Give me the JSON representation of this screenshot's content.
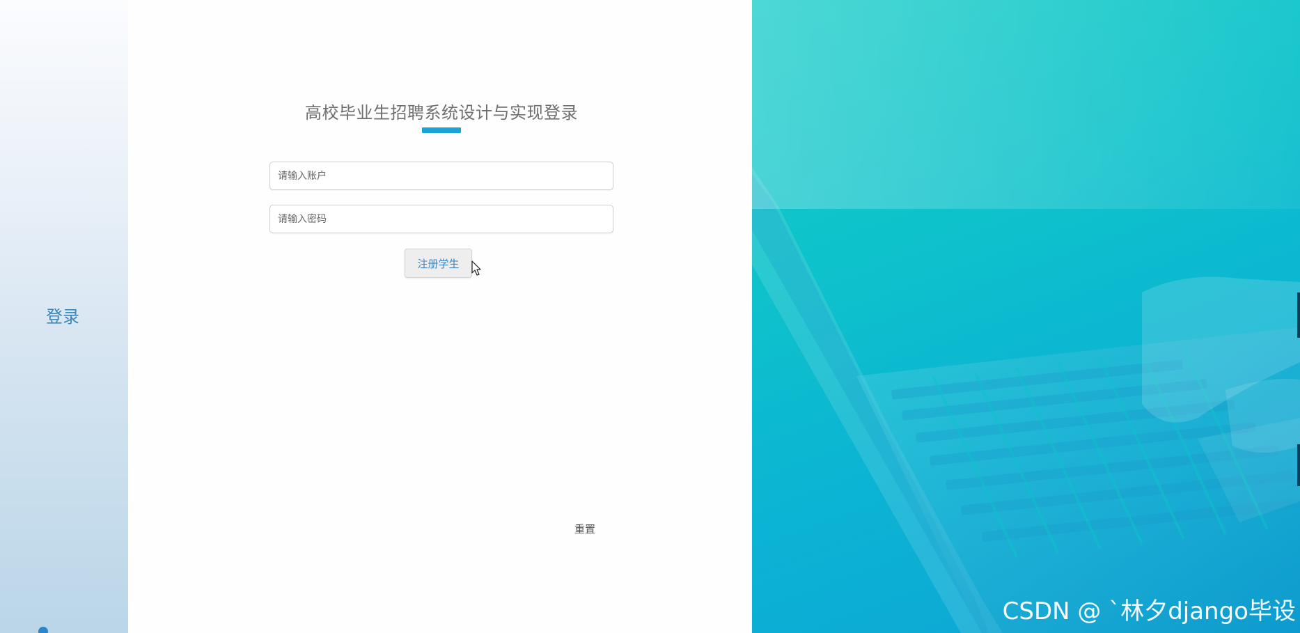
{
  "sidebar": {
    "login_label": "登录"
  },
  "login": {
    "title": "高校毕业生招聘系统设计与实现登录",
    "account_placeholder": "请输入账户",
    "password_placeholder": "请输入密码",
    "register_label": "注册学生",
    "reset_label": "重置"
  },
  "watermark": {
    "text": "CSDN @ ˋ林夕django毕设"
  },
  "colors": {
    "accent": "#1aa3d6",
    "link": "#3d86b8",
    "hero_start": "#12cbc6",
    "hero_end": "#0ea4d6"
  },
  "icons": {
    "cursor": "mouse-pointer-icon",
    "laptop": "laptop-keyboard-illustration"
  }
}
